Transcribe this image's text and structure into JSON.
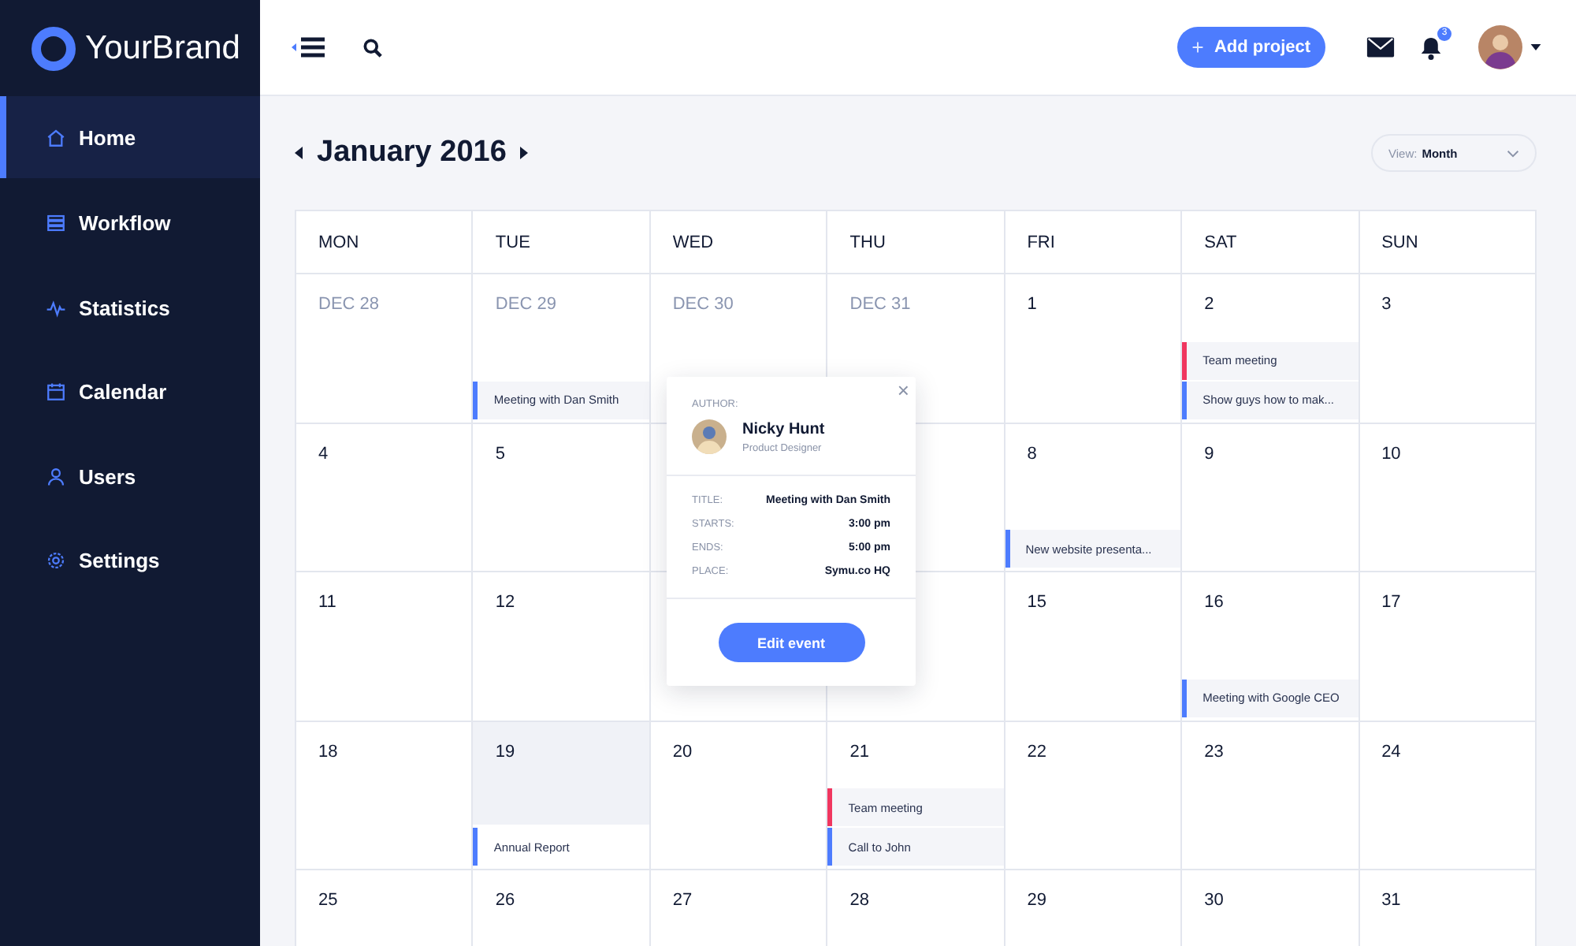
{
  "brand": {
    "name": "YourBrand"
  },
  "sidebar": {
    "items": [
      {
        "label": "Home",
        "selected": true
      },
      {
        "label": "Workflow",
        "selected": false
      },
      {
        "label": "Statistics",
        "selected": false
      },
      {
        "label": "Calendar",
        "selected": false
      },
      {
        "label": "Users",
        "selected": false
      },
      {
        "label": "Settings",
        "selected": false
      }
    ]
  },
  "header": {
    "add_button": "Add project",
    "notification_count": "3"
  },
  "calendar": {
    "month": "January 2016",
    "view_label": "View:",
    "view_value": "Month",
    "weekdays": [
      "MON",
      "TUE",
      "WED",
      "THU",
      "FRI",
      "SAT",
      "SUN"
    ],
    "weeks": [
      {
        "days": [
          {
            "date": "DEC 28",
            "muted": true,
            "selected": false
          },
          {
            "date": "DEC 29",
            "muted": true,
            "selected": false,
            "events": [
              {
                "title": "Meeting with Dan Smith",
                "color": "#4d7cfe"
              }
            ]
          },
          {
            "date": "DEC 30",
            "muted": true,
            "selected": false
          },
          {
            "date": "DEC 31",
            "muted": true,
            "selected": false
          },
          {
            "date": "1",
            "muted": false,
            "selected": false
          },
          {
            "date": "2",
            "muted": false,
            "selected": false,
            "events": [
              {
                "title": "Team meeting",
                "color": "#f0365f"
              },
              {
                "title": "Show guys how to mak...",
                "color": "#4d7cfe"
              }
            ]
          },
          {
            "date": "3",
            "muted": false,
            "selected": false
          }
        ]
      },
      {
        "days": [
          {
            "date": "4",
            "muted": false,
            "selected": false
          },
          {
            "date": "5",
            "muted": false,
            "selected": false
          },
          {
            "selected": false
          },
          {
            "selected": false
          },
          {
            "date": "8",
            "muted": false,
            "selected": false,
            "events": [
              {
                "title": "New website presenta...",
                "color": "#4d7cfe"
              }
            ]
          },
          {
            "date": "9",
            "muted": false,
            "selected": false
          },
          {
            "date": "10",
            "muted": false,
            "selected": false
          }
        ]
      },
      {
        "days": [
          {
            "date": "11",
            "muted": false,
            "selected": false
          },
          {
            "date": "12",
            "muted": false,
            "selected": false
          },
          {
            "selected": false
          },
          {
            "selected": false
          },
          {
            "date": "15",
            "muted": false,
            "selected": false
          },
          {
            "date": "16",
            "muted": false,
            "selected": false,
            "events": [
              {
                "title": "Meeting with Google CEO",
                "color": "#4d7cfe"
              }
            ]
          },
          {
            "date": "17",
            "muted": false,
            "selected": false
          }
        ]
      },
      {
        "days": [
          {
            "date": "18",
            "muted": false,
            "selected": false
          },
          {
            "date": "19",
            "muted": false,
            "selected": true,
            "events": [
              {
                "title": "Annual Report",
                "color": "#4d7cfe"
              }
            ]
          },
          {
            "date": "20",
            "muted": false,
            "selected": false
          },
          {
            "date": "21",
            "muted": false,
            "selected": false,
            "events": [
              {
                "title": "Team meeting",
                "color": "#f0365f"
              },
              {
                "title": "Call to John",
                "color": "#4d7cfe"
              }
            ]
          },
          {
            "date": "22",
            "muted": false,
            "selected": false
          },
          {
            "date": "23",
            "muted": false,
            "selected": false
          },
          {
            "date": "24",
            "muted": false,
            "selected": false
          }
        ]
      },
      {
        "days": [
          {
            "date": "25",
            "muted": false,
            "selected": false
          },
          {
            "date": "26",
            "muted": false,
            "selected": false
          },
          {
            "date": "27",
            "muted": false,
            "selected": false
          },
          {
            "date": "28",
            "muted": false,
            "selected": false
          },
          {
            "date": "29",
            "muted": false,
            "selected": false
          },
          {
            "date": "30",
            "muted": false,
            "selected": false
          },
          {
            "date": "31",
            "muted": false,
            "selected": false
          }
        ]
      }
    ]
  },
  "popover": {
    "close": "×",
    "author_label": "AUTHOR:",
    "author_name": "Nicky Hunt",
    "author_role": "Product Designer",
    "fields": [
      {
        "label": "TITLE:",
        "value": "Meeting with Dan Smith"
      },
      {
        "label": "STARTS:",
        "value": "3:00 pm"
      },
      {
        "label": "ENDS:",
        "value": "5:00 pm"
      },
      {
        "label": "PLACE:",
        "value": "Symu.co HQ"
      }
    ],
    "button": "Edit event"
  }
}
